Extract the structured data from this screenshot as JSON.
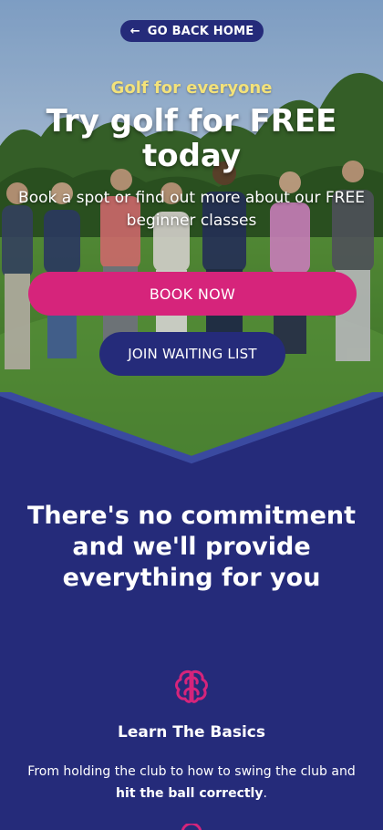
{
  "nav": {
    "back_label": "GO BACK HOME",
    "back_icon": "arrow-left-icon"
  },
  "hero": {
    "kicker": "Golf for everyone",
    "headline": "Try golf for FREE today",
    "subline": "Book a spot or find out more about our FREE beginner classes",
    "book_label": "BOOK NOW",
    "waitlist_label": "JOIN WAITING LIST"
  },
  "section": {
    "title": "There's no commitment and we'll provide everything for you",
    "features": [
      {
        "icon": "brain-icon",
        "title": "Learn The Basics",
        "text_before": "From holding the club to how to swing the club and ",
        "text_bold": "hit the ball correctly",
        "text_after": "."
      }
    ]
  },
  "colors": {
    "navy": "#252b7a",
    "pink": "#d6247b",
    "kicker_yellow": "#f3e27a",
    "chevron_edge": "#3a4aa0"
  }
}
